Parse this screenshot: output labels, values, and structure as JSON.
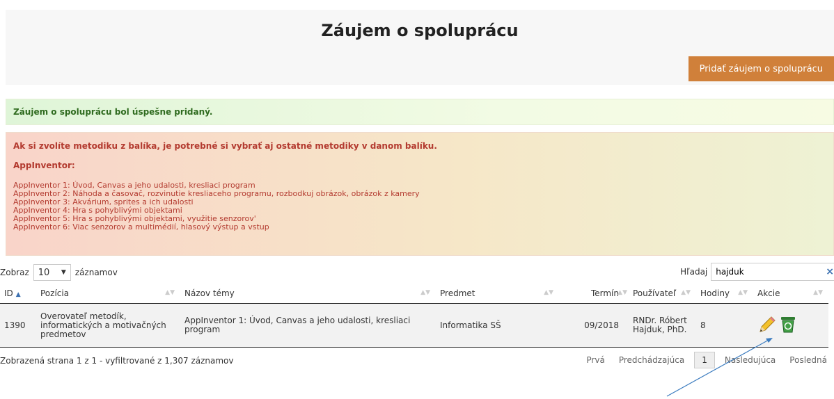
{
  "page": {
    "title": "Záujem o spoluprácu"
  },
  "toolbar": {
    "add_label": "Pridať záujem o spoluprácu"
  },
  "alerts": {
    "success": "Záujem o spoluprácu bol úspešne pridaný.",
    "warning_head": "Ak si zvolíte metodiku z balíka, je potrebné si vybrať aj ostatné metodiky v danom balíku.",
    "warning_subhead": "AppInventor:",
    "warning_items": [
      "AppInventor 1: Úvod, Canvas a jeho udalosti, kresliaci program",
      "AppInventor 2: Náhoda a časovač, rozvinutie kresliaceho programu, rozbodkuj obrázok, obrázok z kamery",
      "AppInventor 3: Akvárium, sprites a ich udalosti",
      "AppInventor 4: Hra s pohyblivými objektami",
      "AppInventor 5: Hra s pohyblivými objektami, využitie senzorov'",
      "AppInventor 6: Viac senzorov a multimédií, hlasový výstup a vstup"
    ]
  },
  "length": {
    "prefix": "Zobraz",
    "value": "10",
    "suffix": "záznamov"
  },
  "search": {
    "label": "Hľadaj",
    "value": "hajduk",
    "clear": "×"
  },
  "table": {
    "headers": {
      "id": "ID",
      "position": "Pozícia",
      "topic": "Názov témy",
      "subject": "Predmet",
      "term": "Termín",
      "user": "Používateľ",
      "hours": "Hodiny",
      "actions": "Akcie"
    },
    "rows": [
      {
        "id": "1390",
        "position": "Overovateľ metodík, informatických a motivačných predmetov",
        "topic": "AppInventor 1: Úvod, Canvas a jeho udalosti, kresliaci program",
        "subject": "Informatika SŠ",
        "term": "09/2018",
        "user": "RNDr. Róbert Hajduk, PhD.",
        "hours": "8"
      }
    ]
  },
  "footer": {
    "info": "Zobrazená strana 1 z 1 - vyfiltrované z 1,307 záznamov",
    "first": "Prvá",
    "prev": "Predchádzajúca",
    "current": "1",
    "next": "Nasledujúca",
    "last": "Posledná"
  },
  "colors": {
    "accent": "#d0803a",
    "success_text": "#2f6b1f",
    "warning_text": "#b33a2f",
    "link_blue": "#3a6fb0"
  }
}
